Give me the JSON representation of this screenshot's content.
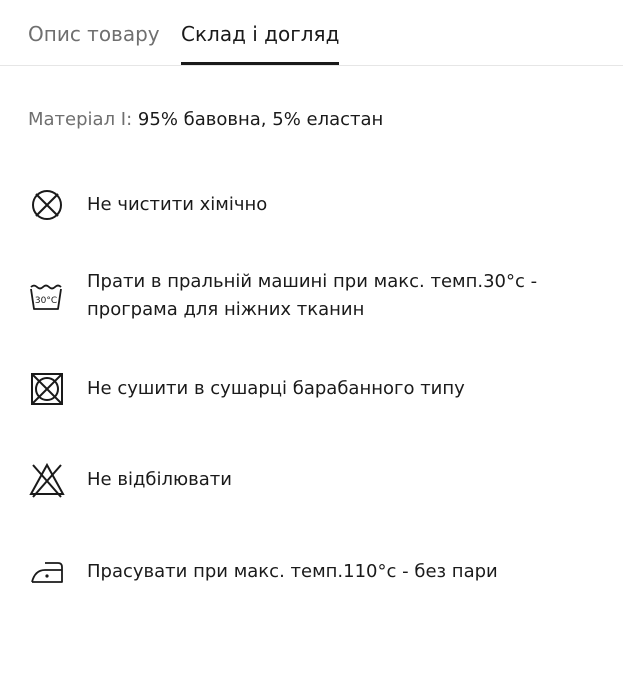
{
  "tabs": [
    {
      "label": "Опис товару",
      "active": false
    },
    {
      "label": "Склад і догляд",
      "active": true
    }
  ],
  "material": {
    "label": "Матеріал І:",
    "value": "95% бавовна, 5% еластан"
  },
  "care": [
    {
      "icon": "no-dry-clean-icon",
      "text": "Не чистити хімічно"
    },
    {
      "icon": "machine-wash-30-icon",
      "icon_text": "30°C",
      "text": "Прати в пральній машині при макс. темп.30°с - програма для ніжних тканин"
    },
    {
      "icon": "no-tumble-dry-icon",
      "text": "Не сушити в сушарці барабанного типу"
    },
    {
      "icon": "no-bleach-icon",
      "text": "Не відбілювати"
    },
    {
      "icon": "iron-low-icon",
      "text": "Прасувати при макс. темп.110°с - без пари"
    }
  ]
}
